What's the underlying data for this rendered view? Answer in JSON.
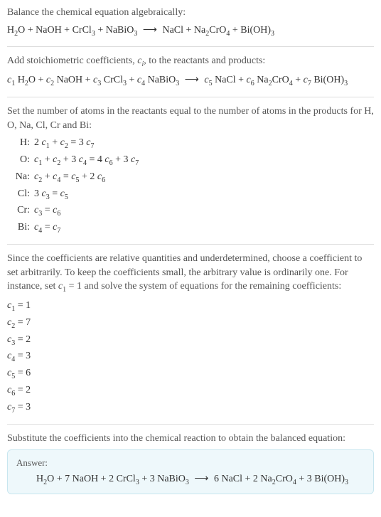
{
  "section1": {
    "intro": "Balance the chemical equation algebraically:",
    "eq_lhs1": "H",
    "eq_lhs1s": "2",
    "eq_lhs1b": "O + NaOH + CrCl",
    "eq_lhs1c": "3",
    "eq_lhs1d": " + NaBiO",
    "eq_lhs1e": "3",
    "arrow": "⟶",
    "eq_rhs1": "NaCl + Na",
    "eq_rhs1s": "2",
    "eq_rhs1b": "CrO",
    "eq_rhs1c": "4",
    "eq_rhs1d": " + Bi(OH)",
    "eq_rhs1e": "3"
  },
  "section2": {
    "intro_a": "Add stoichiometric coefficients, ",
    "intro_ci": "c",
    "intro_i": "i",
    "intro_b": ", to the reactants and products:",
    "c1": "c",
    "c1s": "1",
    "sp1": " H",
    "sp1s": "2",
    "sp1b": "O + ",
    "c2": "c",
    "c2s": "2",
    "sp2": " NaOH + ",
    "c3": "c",
    "c3s": "3",
    "sp3": " CrCl",
    "sp3s": "3",
    "sp3b": " + ",
    "c4": "c",
    "c4s": "4",
    "sp4": " NaBiO",
    "sp4s": "3",
    "arrow": "⟶",
    "c5": "c",
    "c5s": "5",
    "sp5": " NaCl + ",
    "c6": "c",
    "c6s": "6",
    "sp6": " Na",
    "sp6s": "2",
    "sp6b": "CrO",
    "sp6c": "4",
    "sp6d": " + ",
    "c7": "c",
    "c7s": "7",
    "sp7": " Bi(OH)",
    "sp7s": "3"
  },
  "section3": {
    "intro": "Set the number of atoms in the reactants equal to the number of atoms in the products for H, O, Na, Cl, Cr and Bi:",
    "rows": [
      {
        "label": "H:",
        "t": [
          "2 ",
          "c",
          "1",
          " + ",
          "c",
          "2",
          " = 3 ",
          "c",
          "7"
        ]
      },
      {
        "label": "O:",
        "t": [
          "",
          "c",
          "1",
          " + ",
          "c",
          "2",
          " + 3 ",
          "c",
          "4",
          " = 4 ",
          "c",
          "6",
          " + 3 ",
          "c",
          "7"
        ]
      },
      {
        "label": "Na:",
        "t": [
          "",
          "c",
          "2",
          " + ",
          "c",
          "4",
          " = ",
          "c",
          "5",
          " + 2 ",
          "c",
          "6"
        ]
      },
      {
        "label": "Cl:",
        "t": [
          "3 ",
          "c",
          "3",
          " = ",
          "c",
          "5"
        ]
      },
      {
        "label": "Cr:",
        "t": [
          "",
          "c",
          "3",
          " = ",
          "c",
          "6"
        ]
      },
      {
        "label": "Bi:",
        "t": [
          "",
          "c",
          "4",
          " = ",
          "c",
          "7"
        ]
      }
    ]
  },
  "section4": {
    "intro_a": "Since the coefficients are relative quantities and underdetermined, choose a coefficient to set arbitrarily. To keep the coefficients small, the arbitrary value is ordinarily one. For instance, set ",
    "c1": "c",
    "c1s": "1",
    "intro_b": " = 1 and solve the system of equations for the remaining coefficients:",
    "coefs": [
      {
        "c": "c",
        "s": "1",
        "v": " = 1"
      },
      {
        "c": "c",
        "s": "2",
        "v": " = 7"
      },
      {
        "c": "c",
        "s": "3",
        "v": " = 2"
      },
      {
        "c": "c",
        "s": "4",
        "v": " = 3"
      },
      {
        "c": "c",
        "s": "5",
        "v": " = 6"
      },
      {
        "c": "c",
        "s": "6",
        "v": " = 2"
      },
      {
        "c": "c",
        "s": "7",
        "v": " = 3"
      }
    ]
  },
  "section5": {
    "intro": "Substitute the coefficients into the chemical reaction to obtain the balanced equation:"
  },
  "answer": {
    "label": "Answer:",
    "lhs1": "H",
    "lhs1s": "2",
    "lhs1b": "O + 7 NaOH + 2 CrCl",
    "lhs1c": "3",
    "lhs1d": " + 3 NaBiO",
    "lhs1e": "3",
    "arrow": "⟶",
    "rhs1": "6 NaCl + 2 Na",
    "rhs1s": "2",
    "rhs1b": "CrO",
    "rhs1c": "4",
    "rhs1d": " + 3 Bi(OH)",
    "rhs1e": "3"
  }
}
